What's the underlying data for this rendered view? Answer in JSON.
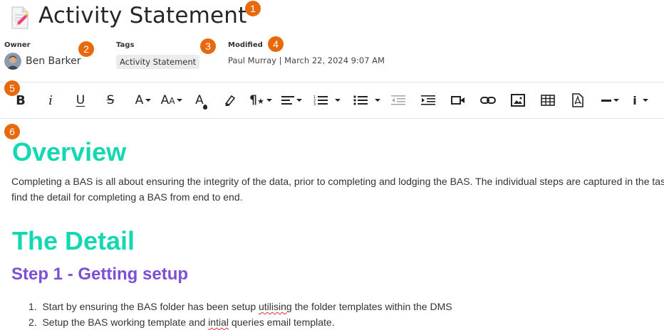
{
  "page": {
    "title": "Activity Statement",
    "doc_icon": "document-edit-icon"
  },
  "meta": {
    "owner_label": "Owner",
    "owner_name": "Ben Barker",
    "tags_label": "Tags",
    "tag": "Activity Statement",
    "modified_label": "Modified",
    "modified_value": "Paul Murray | March 22, 2024 9:07 AM"
  },
  "callouts": [
    "1",
    "2",
    "3",
    "4",
    "5",
    "6"
  ],
  "toolbar": {
    "buttons": [
      "bold-icon",
      "italic-icon",
      "underline-icon",
      "strikethrough-icon",
      "font-color-icon",
      "font-size-icon",
      "text-fill-icon",
      "highlighter-icon",
      "paragraph-style-icon",
      "align-icon",
      "ordered-list-icon",
      "unordered-list-icon",
      "outdent-icon",
      "indent-icon",
      "video-icon",
      "link-icon",
      "image-icon",
      "table-icon",
      "pdf-icon",
      "horizontal-line-icon",
      "info-icon"
    ],
    "accent": "#222222"
  },
  "content": {
    "h1_overview": "Overview",
    "overview_line1": "Completing a BAS is all about ensuring the integrity of the data, prior to completing and lodging the BAS. The individual steps are captured in the tas",
    "overview_line2": "find the detail for completing a BAS from end to end.",
    "h1_detail": "The Detail",
    "h2_step1": "Step 1 - Getting setup",
    "list": {
      "item1_a": "Start by ensuring the BAS folder has been setup ",
      "item1_b": "utilising",
      "item1_c": " the folder templates within the DMS",
      "item2_a": "Setup the BAS working template and ",
      "item2_b": "intial",
      "item2_c": " queries email template."
    },
    "colors": {
      "heading": "#14d8b1",
      "subheading": "#7b4fd6",
      "callout": "#e8690c"
    }
  }
}
